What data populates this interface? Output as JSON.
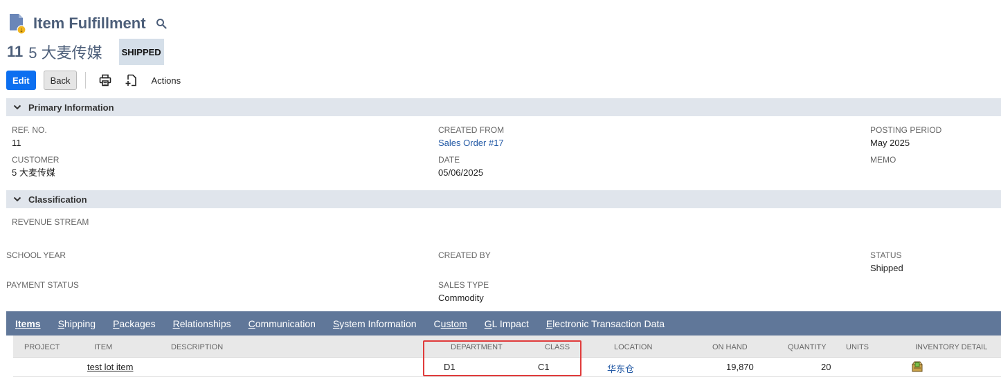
{
  "header": {
    "title": "Item Fulfillment",
    "record_number": "11",
    "record_name": "5 大麦传媒",
    "status": "SHIPPED"
  },
  "toolbar": {
    "edit_label": "Edit",
    "back_label": "Back",
    "actions_label": "Actions"
  },
  "sections": {
    "primary": "Primary Information",
    "classification": "Classification"
  },
  "primary": {
    "ref_no": {
      "label": "REF. NO.",
      "value": "11"
    },
    "created_from": {
      "label": "CREATED FROM",
      "value": "Sales Order #17"
    },
    "posting_period": {
      "label": "POSTING PERIOD",
      "value": "May 2025"
    },
    "customer": {
      "label": "CUSTOMER",
      "value": "5 大麦传媒"
    },
    "date": {
      "label": "DATE",
      "value": "05/06/2025"
    },
    "memo": {
      "label": "MEMO"
    }
  },
  "classification": {
    "revenue_stream": {
      "label": "REVENUE STREAM"
    },
    "school_year": {
      "label": "SCHOOL YEAR"
    },
    "created_by": {
      "label": "CREATED BY"
    },
    "status": {
      "label": "STATUS",
      "value": "Shipped"
    },
    "payment_status": {
      "label": "PAYMENT STATUS"
    },
    "sales_type": {
      "label": "SALES TYPE",
      "value": "Commodity"
    }
  },
  "tabs": [
    {
      "first": "I",
      "rest": "tems"
    },
    {
      "first": "S",
      "rest": "hipping"
    },
    {
      "first": "P",
      "rest": "ackages"
    },
    {
      "first": "R",
      "rest": "elationships"
    },
    {
      "first": "C",
      "rest": "ommunication"
    },
    {
      "first": "S",
      "rest": "ystem Information"
    },
    {
      "first": "C",
      "rest": "ustom"
    },
    {
      "first": "G",
      "rest": "L Impact"
    },
    {
      "first": "E",
      "rest": "lectronic Transaction Data"
    }
  ],
  "grid": {
    "columns": [
      "PROJECT",
      "ITEM",
      "DESCRIPTION",
      "DEPARTMENT",
      "CLASS",
      "LOCATION",
      "ON HAND",
      "QUANTITY",
      "UNITS",
      "INVENTORY DETAIL"
    ],
    "row": {
      "project": "",
      "item": "test lot item",
      "description": "",
      "department": "D1",
      "class": "C1",
      "location": "华东仓",
      "on_hand": "19,870",
      "quantity": "20",
      "units": ""
    }
  },
  "colors": {
    "primary_button": "#0c6ff0",
    "tab_bar": "#607799",
    "section_bar": "#e0e5ec",
    "link": "#255ba6",
    "highlight": "#e03b3b"
  }
}
